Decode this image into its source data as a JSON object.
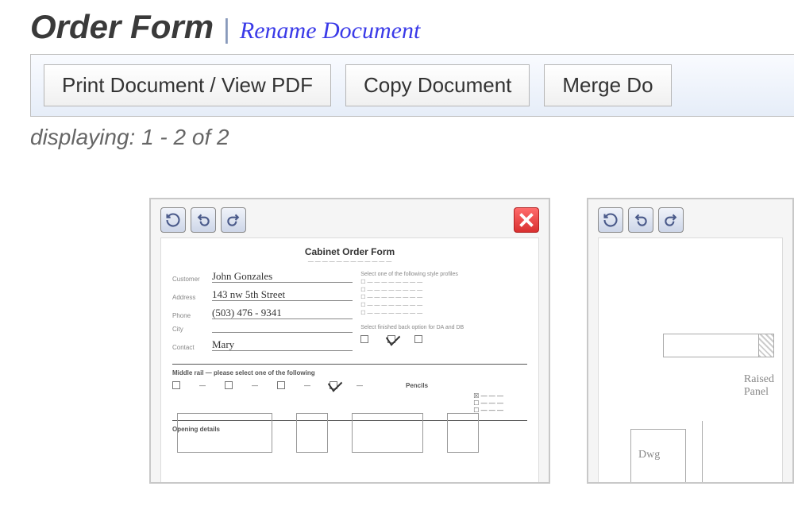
{
  "header": {
    "title": "Order Form",
    "rename_label": "Rename Document"
  },
  "toolbar": {
    "print_label": "Print Document / View PDF",
    "copy_label": "Copy Document",
    "merge_label": "Merge Do"
  },
  "status": {
    "displaying": "displaying: 1 - 2 of 2"
  },
  "thumbnails": [
    {
      "icons": [
        "refresh",
        "rotate-left",
        "rotate-right"
      ],
      "closable": true,
      "form": {
        "title": "Cabinet Order Form",
        "fields": {
          "customer": "",
          "address": "",
          "phone": "",
          "city": "",
          "contact": ""
        }
      }
    },
    {
      "icons": [
        "refresh",
        "rotate-left",
        "rotate-right"
      ],
      "closable": false
    }
  ]
}
